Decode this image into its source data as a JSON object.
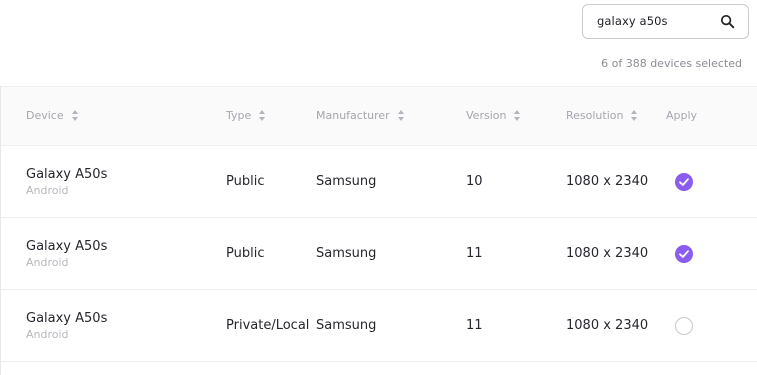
{
  "search": {
    "value": "galaxy a50s"
  },
  "selection": {
    "count_text": "6 of 388 devices selected"
  },
  "table": {
    "headers": {
      "device": "Device",
      "type": "Type",
      "manufacturer": "Manufacturer",
      "version": "Version",
      "resolution": "Resolution",
      "apply": "Apply"
    },
    "rows": [
      {
        "device": "Galaxy A50s",
        "os": "Android",
        "type": "Public",
        "manufacturer": "Samsung",
        "version": "10",
        "resolution": "1080 x 2340",
        "applied": true
      },
      {
        "device": "Galaxy A50s",
        "os": "Android",
        "type": "Public",
        "manufacturer": "Samsung",
        "version": "11",
        "resolution": "1080 x 2340",
        "applied": true
      },
      {
        "device": "Galaxy A50s",
        "os": "Android",
        "type": "Private/Local",
        "manufacturer": "Samsung",
        "version": "11",
        "resolution": "1080 x 2340",
        "applied": false
      }
    ]
  },
  "colors": {
    "accent": "#8b5cf0"
  }
}
